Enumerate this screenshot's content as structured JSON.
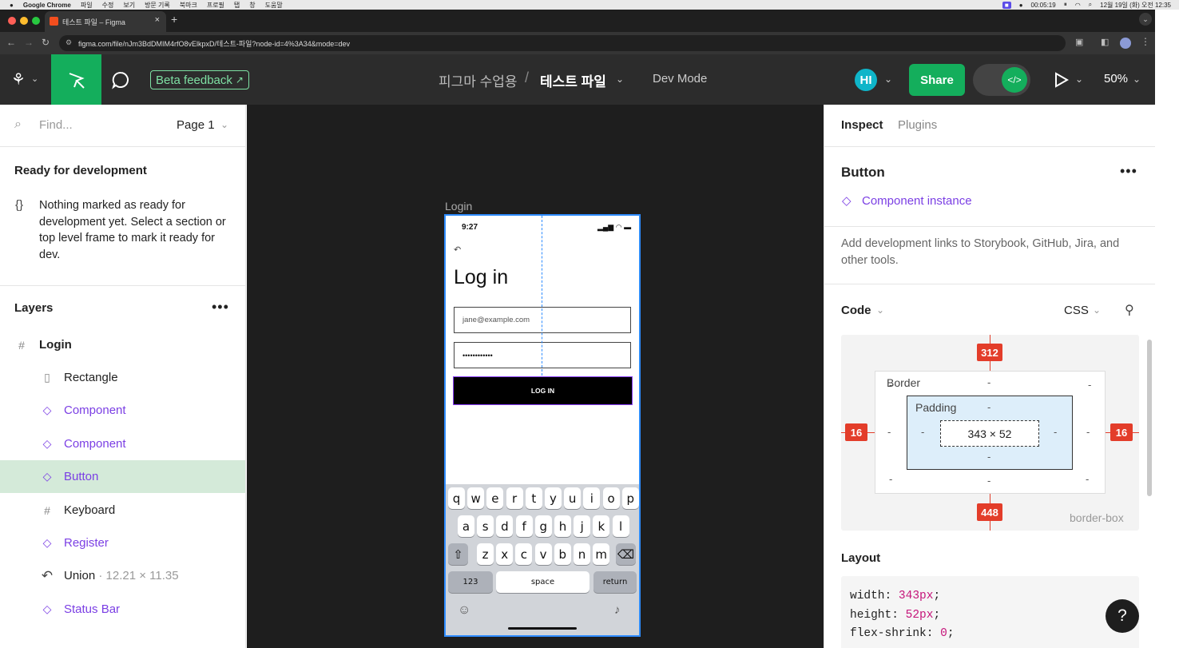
{
  "macos": {
    "app_name": "Google Chrome",
    "menu": [
      "파일",
      "수정",
      "보기",
      "방문 기록",
      "북마크",
      "프로필",
      "탭",
      "창",
      "도움말"
    ],
    "record_time": "00:05:19",
    "date_time": "12월 19일 (화) 오전 12:35"
  },
  "browser": {
    "tab_title": "테스트 파일 – Figma",
    "url": "figma.com/file/nJm3BdDMIM4rfO8vElkpxD/테스트-파일?node-id=4%3A34&mode=dev"
  },
  "toolbar": {
    "beta_feedback": "Beta feedback",
    "project": "피그마 수업용",
    "separator": "/",
    "file_name": "테스트 파일",
    "mode": "Dev Mode",
    "avatar_initials": "HI",
    "share": "Share",
    "zoom": "50%"
  },
  "left": {
    "search_placeholder": "Find...",
    "page": "Page 1",
    "ready_title": "Ready for development",
    "ready_text": "Nothing marked as ready for development yet. Select a section or top level frame to mark it ready for dev.",
    "layers_title": "Layers",
    "layers": [
      {
        "label": "Login",
        "icon": "frame-icon",
        "sub": ""
      },
      {
        "label": "Rectangle",
        "icon": "rectangle-icon",
        "sub": ""
      },
      {
        "label": "Component",
        "icon": "component-icon",
        "sub": ""
      },
      {
        "label": "Component",
        "icon": "component-icon",
        "sub": ""
      },
      {
        "label": "Button",
        "icon": "component-icon",
        "sub": ""
      },
      {
        "label": "Keyboard",
        "icon": "frame-icon",
        "sub": ""
      },
      {
        "label": "Register",
        "icon": "component-icon",
        "sub": ""
      },
      {
        "label": "Union",
        "icon": "vector-icon",
        "sub": " · 12.21 × 11.35"
      },
      {
        "label": "Status Bar",
        "icon": "component-icon",
        "sub": ""
      }
    ]
  },
  "canvas": {
    "frame_label": "Login",
    "time": "9:27",
    "title": "Log in",
    "email": "jane@example.com",
    "password": "••••••••••••",
    "button": "LOG IN",
    "keys_row1": [
      "q",
      "w",
      "e",
      "r",
      "t",
      "y",
      "u",
      "i",
      "o",
      "p"
    ],
    "keys_row2": [
      "a",
      "s",
      "d",
      "f",
      "g",
      "h",
      "j",
      "k",
      "l"
    ],
    "keys_row3": [
      "z",
      "x",
      "c",
      "v",
      "b",
      "n",
      "m"
    ],
    "key_123": "123",
    "key_space": "space",
    "key_return": "return"
  },
  "right": {
    "tab_inspect": "Inspect",
    "tab_plugins": "Plugins",
    "selection": "Button",
    "instance": "Component instance",
    "dev_links": "Add development links to Storybook, GitHub, Jira, and other tools.",
    "code": "Code",
    "language": "CSS",
    "box": {
      "top": "312",
      "bottom": "448",
      "left": "16",
      "right": "16",
      "border": "Border",
      "padding": "Padding",
      "size": "343 × 52",
      "dash": "-",
      "sizing": "border-box"
    },
    "layout_title": "Layout",
    "css": [
      {
        "prop": "width",
        "val": "343px"
      },
      {
        "prop": "height",
        "val": "52px"
      },
      {
        "prop": "flex-shrink",
        "val": "0"
      }
    ],
    "help": "?"
  },
  "colors": {
    "figma_green": "#14ae5c",
    "selection_blue": "#2e8cff",
    "selection_layer_bg": "#d4ead9",
    "badge_red": "#e33d2a",
    "component_purple": "#7b3fe4"
  }
}
